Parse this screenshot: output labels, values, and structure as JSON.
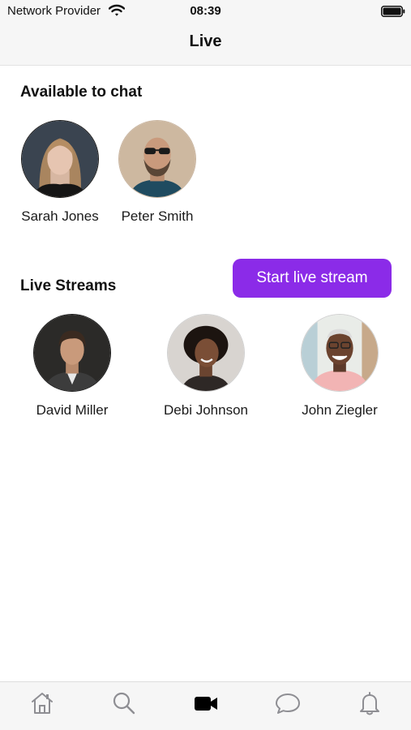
{
  "status_bar": {
    "carrier": "Network Provider",
    "time": "08:39"
  },
  "header": {
    "title": "Live"
  },
  "available_to_chat": {
    "title": "Available to chat",
    "people": [
      {
        "name": "Sarah Jones"
      },
      {
        "name": "Peter Smith"
      }
    ]
  },
  "live_streams": {
    "title": "Live Streams",
    "start_button_label": "Start live stream",
    "people": [
      {
        "name": "David Miller"
      },
      {
        "name": "Debi Johnson"
      },
      {
        "name": "John Ziegler"
      }
    ]
  },
  "tab_bar": {
    "tabs": [
      {
        "icon": "home-icon",
        "active": false
      },
      {
        "icon": "search-icon",
        "active": false
      },
      {
        "icon": "video-camera-icon",
        "active": true
      },
      {
        "icon": "chat-bubble-icon",
        "active": false
      },
      {
        "icon": "bell-icon",
        "active": false
      }
    ]
  },
  "colors": {
    "accent": "#8b2be8",
    "tab_inactive": "#8e8e93",
    "tab_active": "#000000"
  }
}
